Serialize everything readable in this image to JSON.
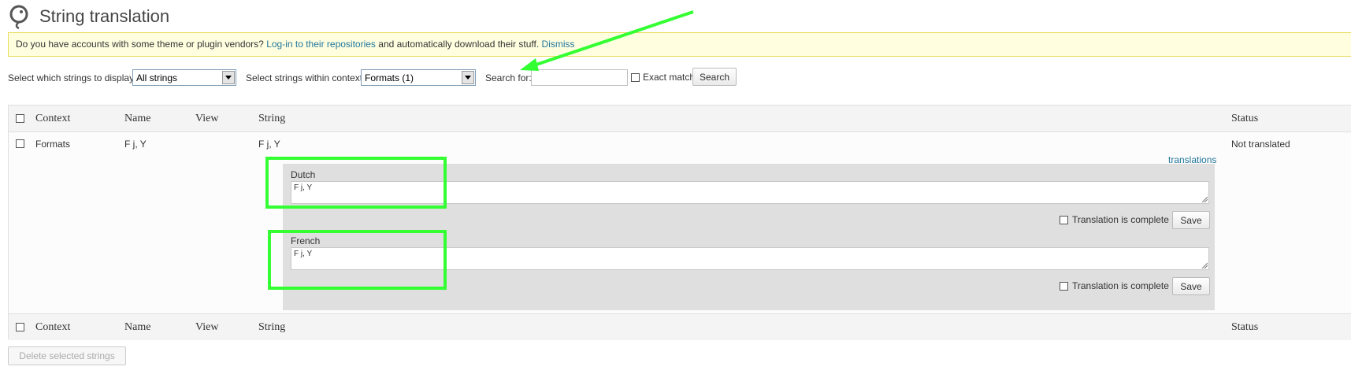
{
  "page": {
    "title": "String translation"
  },
  "notice": {
    "text_before": "Do you have accounts with some theme or plugin vendors?",
    "link_text": "Log-in to their repositories",
    "text_after": "and automatically download their stuff.",
    "dismiss_text": "Dismiss"
  },
  "filters": {
    "display_label": "Select which strings to display:",
    "display_value": "All strings",
    "context_label": "Select strings within context:",
    "context_value": "Formats (1)",
    "search_label": "Search for:",
    "search_value": "",
    "exact_match_label": "Exact match",
    "search_button": "Search"
  },
  "table": {
    "columns": {
      "context": "Context",
      "name": "Name",
      "view": "View",
      "string": "String",
      "status": "Status"
    },
    "rows": [
      {
        "context": "Formats",
        "name": "F j, Y",
        "view": "",
        "string": "F j, Y",
        "status": "Not translated",
        "translations_link": "translations",
        "translations": [
          {
            "language": "Dutch",
            "value": "F j, Y",
            "complete_label": "Translation is complete",
            "save_label": "Save"
          },
          {
            "language": "French",
            "value": "F j, Y",
            "complete_label": "Translation is complete",
            "save_label": "Save"
          }
        ]
      }
    ]
  },
  "footer": {
    "delete_button": "Delete selected strings"
  },
  "colors": {
    "annotation": "#33ff33",
    "link": "#21759b",
    "notice_bg": "#ffffe0",
    "notice_border": "#e6db55",
    "panel_bg": "#dfdfdf"
  },
  "icons": {
    "logo": "wpml-logo-icon",
    "dropdown": "chevron-down-icon",
    "resize": "resize-grip-icon"
  }
}
